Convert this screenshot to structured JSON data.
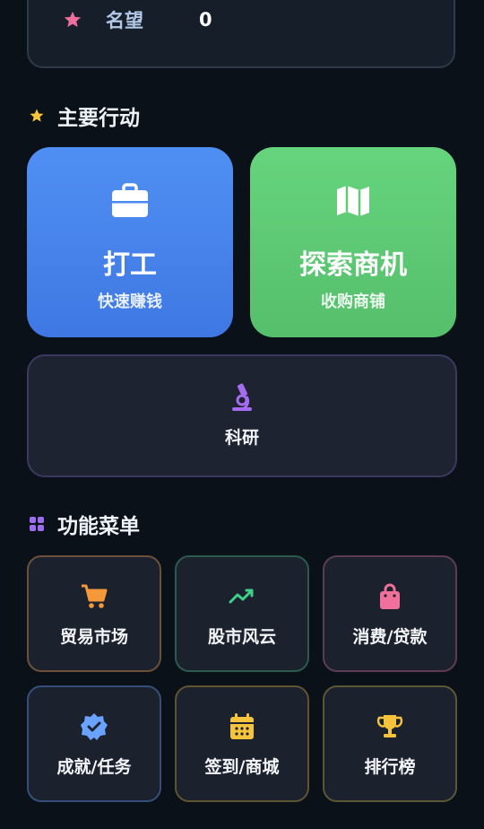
{
  "stats": {
    "reputation_label": "名望",
    "reputation_value": "0"
  },
  "main_actions": {
    "title": "主要行动",
    "work": {
      "title": "打工",
      "subtitle": "快速赚钱"
    },
    "explore": {
      "title": "探索商机",
      "subtitle": "收购商铺"
    },
    "research": {
      "label": "科研"
    }
  },
  "function_menu": {
    "title": "功能菜单",
    "items": [
      {
        "label": "贸易市场",
        "icon": "cart-icon"
      },
      {
        "label": "股市风云",
        "icon": "trend-line-icon"
      },
      {
        "label": "消费/贷款",
        "icon": "shopping-bag-icon"
      },
      {
        "label": "成就/任务",
        "icon": "verified-badge-icon"
      },
      {
        "label": "签到/商城",
        "icon": "calendar-icon"
      },
      {
        "label": "排行榜",
        "icon": "trophy-icon"
      }
    ]
  },
  "colors": {
    "background": "#0b1119",
    "work_card": "#4a87ef",
    "explore_card": "#5fcb75",
    "star_pink": "#f06e9c",
    "star_yellow": "#f5c43c",
    "grid_purple": "#9b6ef0",
    "microscope_purple": "#a56cf0",
    "cart_orange": "#f4983a",
    "trend_green": "#3fd08a",
    "bag_pink": "#f0709c",
    "badge_blue": "#6aa2ff",
    "calendar_yellow": "#f5c43c",
    "trophy_yellow": "#f5c43c"
  }
}
